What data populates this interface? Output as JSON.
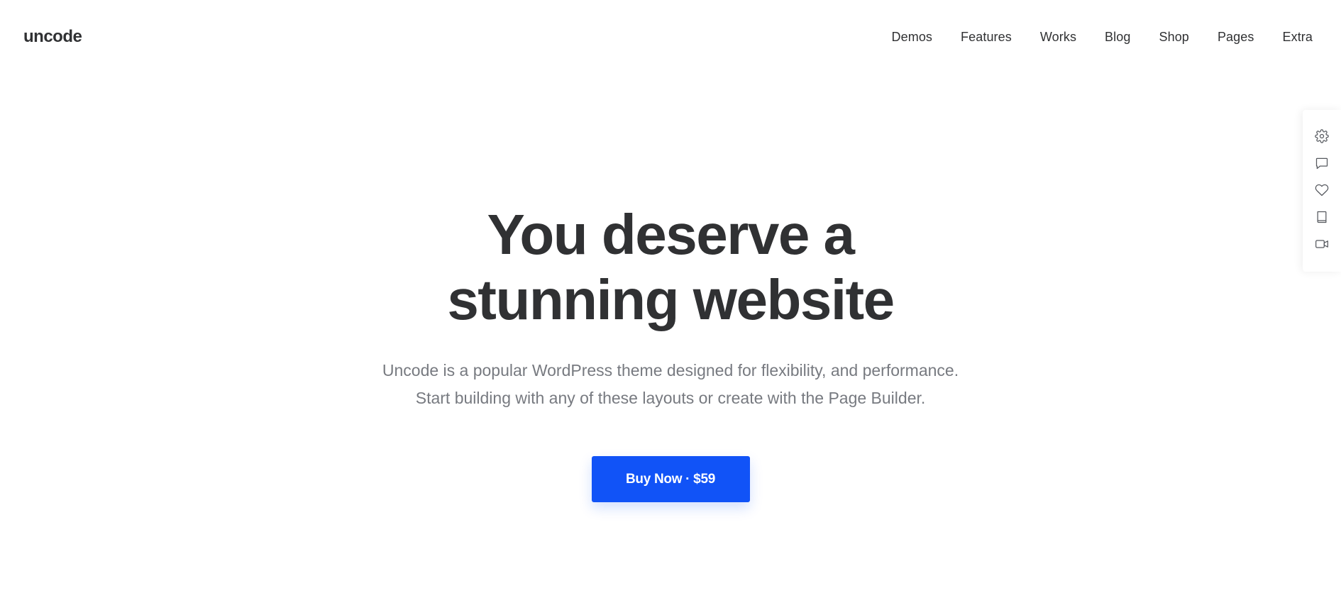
{
  "header": {
    "logo": "uncode",
    "nav": [
      {
        "label": "Demos"
      },
      {
        "label": "Features"
      },
      {
        "label": "Works"
      },
      {
        "label": "Blog"
      },
      {
        "label": "Shop"
      },
      {
        "label": "Pages"
      },
      {
        "label": "Extra"
      }
    ]
  },
  "hero": {
    "title_line1": "You deserve a",
    "title_line2": "stunning website",
    "subtitle_line1": "Uncode is a popular WordPress theme designed for flexibility, and performance.",
    "subtitle_line2": "Start building with any of these layouts or create with the Page Builder.",
    "cta_label": "Buy Now · $59"
  },
  "side_panel": {
    "icons": [
      "gear-icon",
      "chat-bubble-icon",
      "heart-icon",
      "book-icon",
      "video-camera-icon"
    ]
  },
  "colors": {
    "accent": "#1153f7",
    "heading": "#303133",
    "subtext": "#777a80",
    "background": "#ffffff"
  }
}
